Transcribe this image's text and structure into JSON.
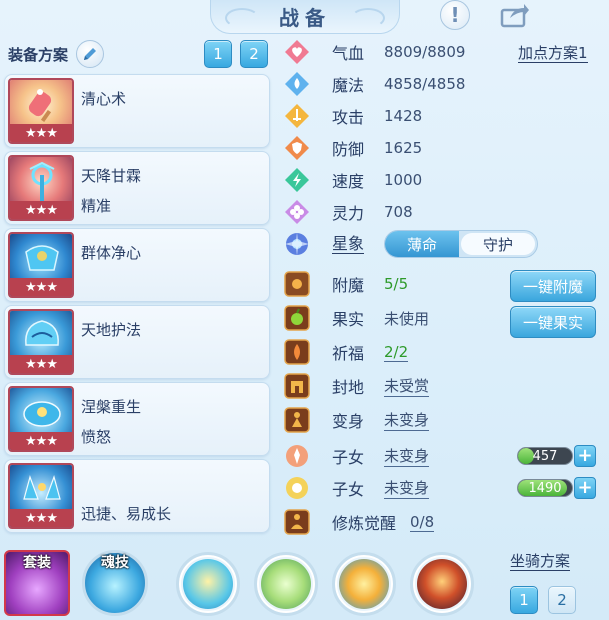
{
  "header": {
    "title": "战备"
  },
  "equip": {
    "title": "装备方案",
    "scheme_buttons": [
      "1",
      "2"
    ]
  },
  "skills": [
    {
      "name": "清心术",
      "sub": "",
      "stars": "★★★"
    },
    {
      "name": "天降甘霖",
      "sub": "精准",
      "stars": "★★★"
    },
    {
      "name": "群体净心",
      "sub": "",
      "stars": "★★★"
    },
    {
      "name": "天地护法",
      "sub": "",
      "stars": "★★★"
    },
    {
      "name": "涅槃重生",
      "sub": "愤怒",
      "stars": "★★★"
    },
    {
      "name": "",
      "sub": "迅捷、易成长",
      "stars": "★★★"
    }
  ],
  "stats": {
    "add_point_scheme": "加点方案1",
    "hp": {
      "label": "气血",
      "value": "8809/8809"
    },
    "mp": {
      "label": "魔法",
      "value": "4858/4858"
    },
    "atk": {
      "label": "攻击",
      "value": "1428"
    },
    "def": {
      "label": "防御",
      "value": "1625"
    },
    "spd": {
      "label": "速度",
      "value": "1000"
    },
    "spi": {
      "label": "灵力",
      "value": "708"
    },
    "star": {
      "label": "星象",
      "options": [
        "薄命",
        "守护"
      ],
      "selected": "守护"
    },
    "enchant": {
      "label": "附魔",
      "value": "5/5",
      "button": "一键附魔"
    },
    "fruit": {
      "label": "果实",
      "value": "未使用",
      "button": "一键果实"
    },
    "blessing": {
      "label": "祈福",
      "value": "2/2"
    },
    "fief": {
      "label": "封地",
      "value": "未受赏"
    },
    "transform": {
      "label": "变身",
      "value": "未变身"
    },
    "child1": {
      "label": "子女",
      "value": "未变身",
      "bar_value": "457",
      "bar_fill": 0.3
    },
    "child2": {
      "label": "子女",
      "value": "未变身",
      "bar_value": "1490",
      "bar_fill": 0.9
    },
    "cultivation": {
      "label": "修炼觉醒",
      "value": "0/8"
    }
  },
  "bottom": {
    "set_label": "套装",
    "soul_label": "魂技",
    "mount_label": "坐骑方案",
    "mount_buttons": [
      "1",
      "2"
    ]
  },
  "colors": {
    "accent_blue": "#38a8e0",
    "star_red": "#b8414f",
    "green_value": "#2e9a2a"
  }
}
